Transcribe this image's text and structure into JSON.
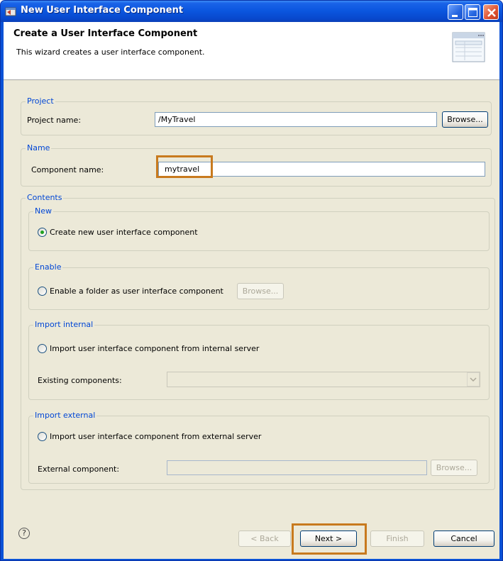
{
  "window": {
    "title": "New User Interface Component"
  },
  "banner": {
    "title": "Create a User Interface Component",
    "description": "This wizard creates a user interface component."
  },
  "project": {
    "legend": "Project",
    "name_label": "Project name:",
    "name_value": "/MyTravel",
    "browse_label": "Browse..."
  },
  "name": {
    "legend": "Name",
    "component_label": "Component name:",
    "component_value": "mytravel"
  },
  "contents": {
    "legend": "Contents",
    "new": {
      "legend": "New",
      "option_label": "Create new user interface component",
      "selected": true
    },
    "enable": {
      "legend": "Enable",
      "option_label": "Enable a folder as user interface component",
      "browse_label": "Browse..."
    },
    "import_internal": {
      "legend": "Import internal",
      "option_label": "Import user interface component from internal server",
      "existing_label": "Existing components:",
      "existing_value": ""
    },
    "import_external": {
      "legend": "Import external",
      "option_label": "Import user interface component from external server",
      "external_label": "External component:",
      "external_value": "",
      "browse_label": "Browse..."
    }
  },
  "footer": {
    "help_symbol": "?",
    "back_label": "< Back",
    "next_label": "Next >",
    "finish_label": "Finish",
    "cancel_label": "Cancel"
  },
  "colors": {
    "title_bar": "#0a55de",
    "legend_text": "#0046d5",
    "highlight_border": "#c87a1e",
    "dialog_background": "#ece9d8"
  }
}
